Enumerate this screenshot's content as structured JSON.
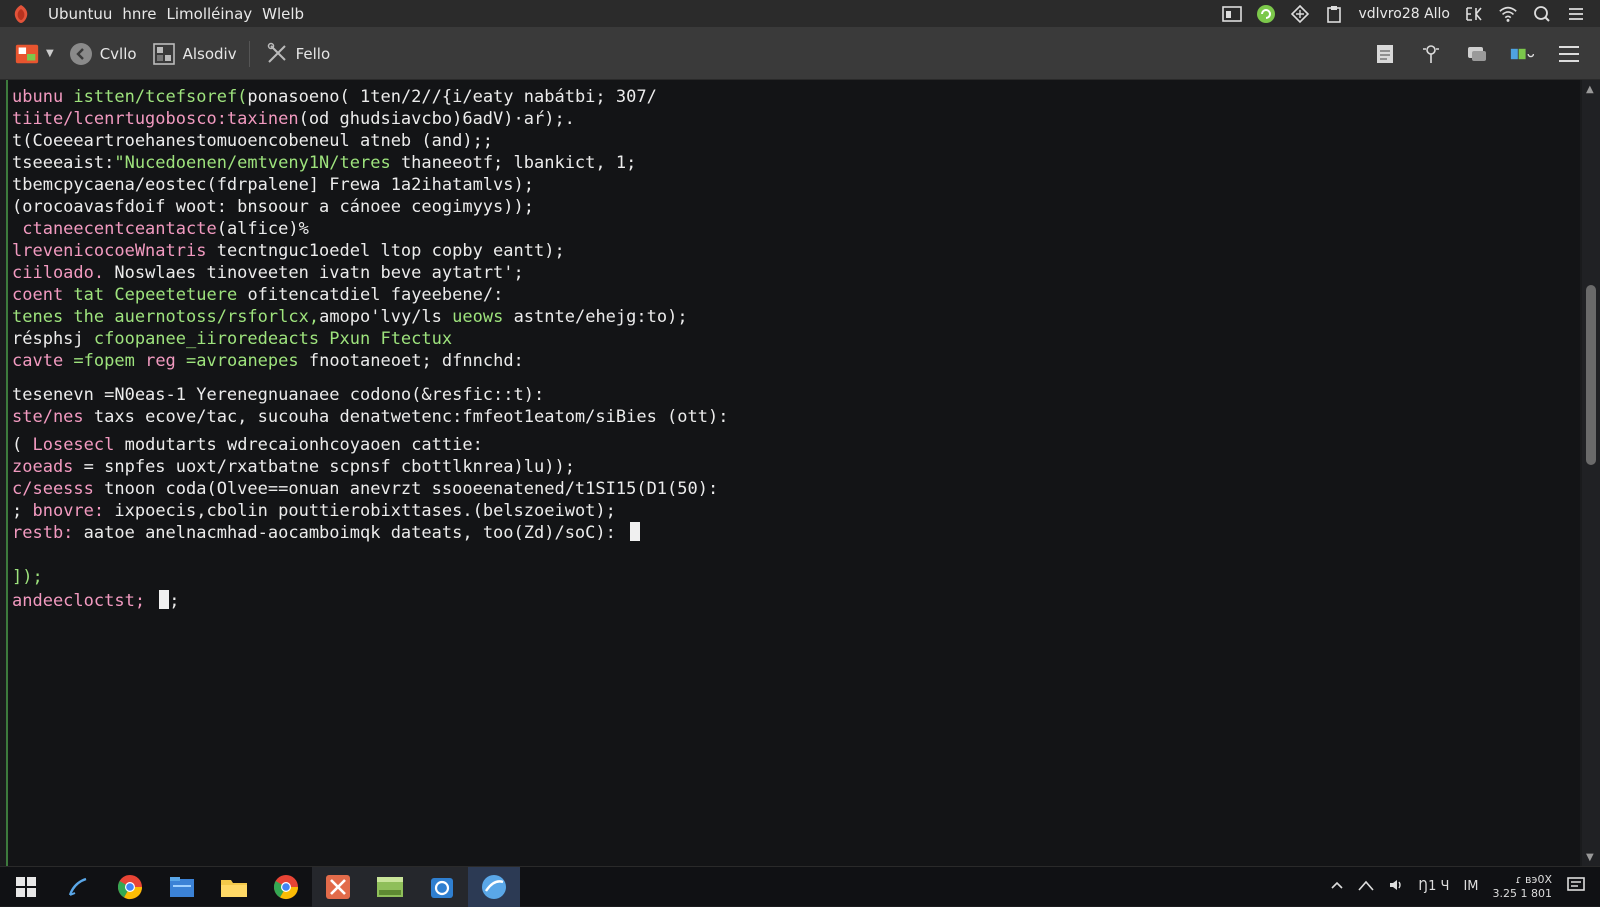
{
  "topbar": {
    "menu": [
      "Ubuntuu",
      "hnre",
      "Limolléinay",
      "Wlelb"
    ],
    "status_text": "vdlvro28 Allo"
  },
  "toolbar": {
    "button1_label": "Cvllo",
    "button2_label": "Alsodiv",
    "button3_label": "Fello"
  },
  "terminal": {
    "lines": [
      {
        "segments": [
          {
            "t": "ubunu ",
            "c": "pink"
          },
          {
            "t": "istten/tcefsoref(",
            "c": "green"
          },
          {
            "t": "ponasoeno( 1ten/2//{i/eaty nabátbi; 307/",
            "c": "white"
          }
        ]
      },
      {
        "segments": [
          {
            "t": "tiite/lcenrtugobosco:taxinen",
            "c": "pink"
          },
          {
            "t": "(od ghudsiavcbo)6adV)·aŕ);.",
            "c": "white"
          }
        ]
      },
      {
        "segments": [
          {
            "t": "t(Coeeeartroehanestomuoencobeneul atneb (and);;",
            "c": "white"
          }
        ]
      },
      {
        "segments": [
          {
            "t": "tseeeaist:",
            "c": "white"
          },
          {
            "t": "\"Nucedoenen/emtveny1N/teres ",
            "c": "green"
          },
          {
            "t": "thaneeotf; lbankict, 1;",
            "c": "white"
          }
        ]
      },
      {
        "segments": [
          {
            "t": "tbemcpycaena/eostec(fdrpalene] Frewa 1a2ihatamlvs);",
            "c": "white"
          }
        ]
      },
      {
        "segments": [
          {
            "t": "(orocoavasfdoif woot: bnsoour a cánoee ceogimyys));",
            "c": "white"
          }
        ]
      },
      {
        "segments": [
          {
            "t": " ctaneecentceantacte",
            "c": "pink"
          },
          {
            "t": "(alfice)%",
            "c": "white"
          }
        ]
      },
      {
        "segments": [
          {
            "t": "lrevenicocoeWnatris ",
            "c": "pink"
          },
          {
            "t": "tecntnguc1oedel ltop copby eantt);",
            "c": "white"
          }
        ]
      },
      {
        "segments": [
          {
            "t": "ciiloado. ",
            "c": "pink"
          },
          {
            "t": "Noswlaes tinoveeten ivatn beve aytatrt';",
            "c": "white"
          }
        ]
      },
      {
        "segments": [
          {
            "t": "coent ",
            "c": "pink"
          },
          {
            "t": "tat ",
            "c": "green"
          },
          {
            "t": "Cepeetetuere ",
            "c": "green"
          },
          {
            "t": "ofitencatdiel fayeebene/:",
            "c": "white"
          }
        ]
      },
      {
        "segments": [
          {
            "t": "tenes ",
            "c": "green"
          },
          {
            "t": "the ",
            "c": "green"
          },
          {
            "t": "auernotoss/rsforlcx,",
            "c": "green"
          },
          {
            "t": "amopo'lvy/ls ",
            "c": "white"
          },
          {
            "t": "ueows ",
            "c": "green"
          },
          {
            "t": "astnte/ehejg:to);",
            "c": "white"
          }
        ]
      },
      {
        "segments": [
          {
            "t": "résphsj ",
            "c": "white"
          },
          {
            "t": "cfoopanee_iiroredeacts Pxun Ftectux",
            "c": "green"
          }
        ]
      },
      {
        "segments": [
          {
            "t": "cavte ",
            "c": "pink"
          },
          {
            "t": "=fopem ",
            "c": "green"
          },
          {
            "t": "reg ",
            "c": "pink"
          },
          {
            "t": "=avroanepes ",
            "c": "green"
          },
          {
            "t": "fnootaneoet; dfnnchd:",
            "c": "white"
          }
        ]
      },
      {
        "segments": [
          {
            "t": "tesenevn =N0eas-1 Yerenegnuanaee codono(&resfic::t):",
            "c": "white"
          }
        ]
      },
      {
        "segments": [
          {
            "t": "ste/nes ",
            "c": "pink"
          },
          {
            "t": "taxs ecove/tac, sucouha denatwetenc:fmfeot1eatom/siBies (ott):",
            "c": "white"
          }
        ]
      },
      {
        "segments": [
          {
            "t": "( ",
            "c": "white"
          },
          {
            "t": "Losesecl ",
            "c": "pink"
          },
          {
            "t": "modutarts ",
            "c": "white"
          },
          {
            "t": "wdrecaionhcoyaoen cattie:",
            "c": "white"
          }
        ]
      },
      {
        "segments": [
          {
            "t": "zoeads ",
            "c": "pink"
          },
          {
            "t": "= snpfes uoxt/rxatbatne scpnsf cbottlknrea)lu));",
            "c": "white"
          }
        ]
      },
      {
        "segments": [
          {
            "t": "c/seesss ",
            "c": "pink"
          },
          {
            "t": "tnoon coda(Olvee==onuan anevrzt ssooeenatened/t1SI15(D1(50):",
            "c": "white"
          }
        ]
      },
      {
        "segments": [
          {
            "t": "; ",
            "c": "white"
          },
          {
            "t": "bnovre: ",
            "c": "pink"
          },
          {
            "t": "ixpoecis,cbolin pouttierobixttases.(belszoeiwot);",
            "c": "white"
          }
        ]
      },
      {
        "segments": [
          {
            "t": "restb: ",
            "c": "pink"
          },
          {
            "t": "aatoe anelnacmhad-aocamboimqk dateats, too(Zd)/soC): ",
            "c": "white"
          }
        ],
        "cursor": true
      },
      {
        "segments": [
          {
            "t": "",
            "c": "white"
          }
        ]
      },
      {
        "segments": [
          {
            "t": "]);",
            "c": "green"
          }
        ]
      },
      {
        "segments": [
          {
            "t": "andeeclоctst; ",
            "c": "pink"
          }
        ],
        "cursor": true,
        "after": ";"
      }
    ]
  },
  "colors": {
    "pink": "#f29ac0",
    "green": "#9ee37d",
    "white": "#ececec"
  },
  "taskbar": {
    "tray_a": "Ŋ1 Ч",
    "tray_b": "IM",
    "clock_time": "ɾ вэ0Х",
    "clock_date": "3.25 1 801"
  }
}
